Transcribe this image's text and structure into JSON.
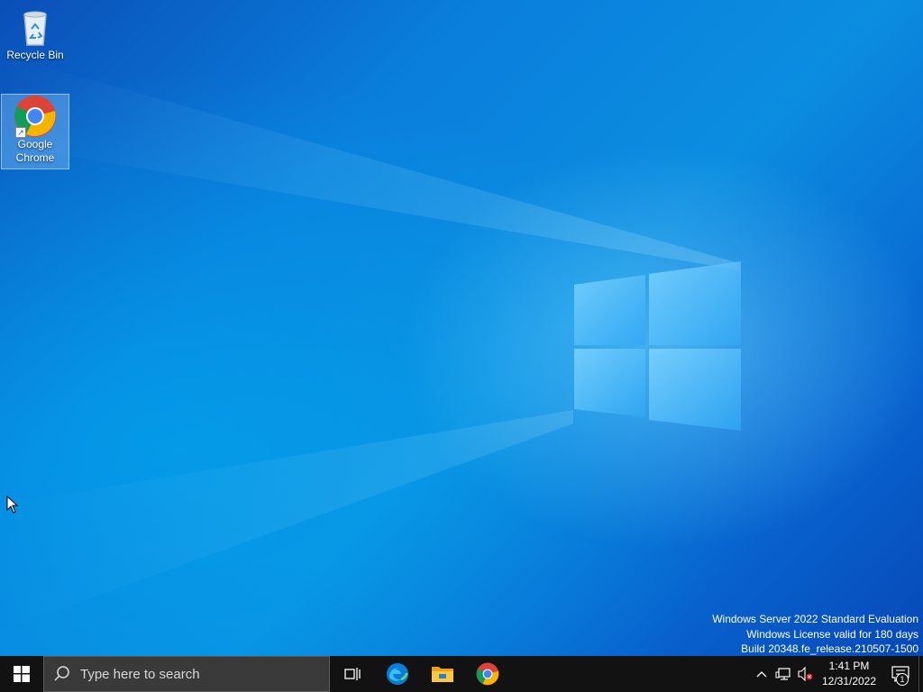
{
  "desktop": {
    "icons": [
      {
        "label": "Recycle Bin",
        "icon": "recycle-bin-icon"
      },
      {
        "label": "Google\nChrome",
        "icon": "chrome-icon",
        "selected": true
      }
    ],
    "watermark": {
      "line1": "Windows Server 2022 Standard Evaluation",
      "line2": "Windows License valid for 180 days",
      "line3": "Build 20348.fe_release.210507-1500"
    }
  },
  "taskbar": {
    "start": "windows-start-icon",
    "search": {
      "placeholder": "Type here to search"
    },
    "pinned": [
      "task-view-icon",
      "edge-icon",
      "file-explorer-icon",
      "chrome-icon"
    ],
    "tray": {
      "icons": [
        "chevron-up-icon",
        "network-icon",
        "volume-muted-icon"
      ],
      "time": "1:41 PM",
      "date": "12/31/2022",
      "notification_count": "1"
    }
  },
  "colors": {
    "taskbar": "#121212",
    "accent": "#0a7fdc"
  }
}
